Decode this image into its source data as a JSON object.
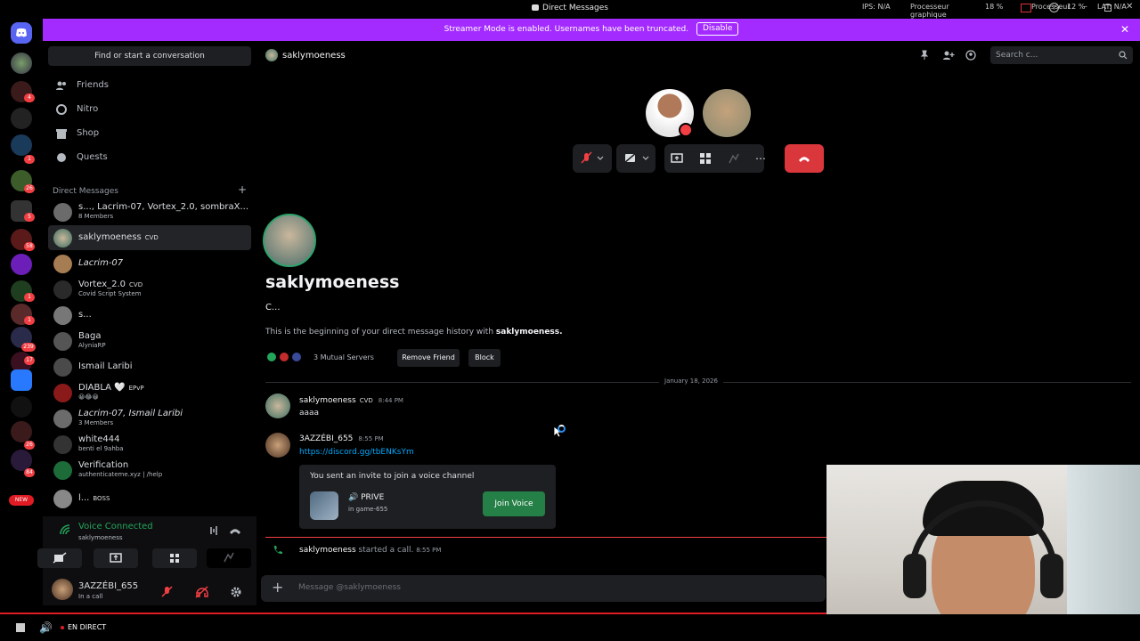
{
  "window": {
    "title": "Direct Messages",
    "stats": {
      "ips": "IPS: N/A",
      "gpu_label": "Processeur graphique",
      "gpu_value": "18 %",
      "cpu_label": "Processeur",
      "cpu_value": "12 %",
      "lat": "LAT: N/A"
    }
  },
  "banner": {
    "text": "Streamer Mode is enabled. Usernames have been truncated.",
    "disable_label": "Disable"
  },
  "sidebar": {
    "search_placeholder": "Find or start a conversation",
    "nav": [
      {
        "label": "Friends"
      },
      {
        "label": "Nitro"
      },
      {
        "label": "Shop"
      },
      {
        "label": "Quests"
      }
    ],
    "dm_header": "Direct Messages",
    "dms": [
      {
        "name": "s..., Lacrim-07, Vortex_2.0, sombraX...",
        "sub": "8 Members"
      },
      {
        "name": "saklymoeness",
        "tag": "CVD",
        "sub": ""
      },
      {
        "name": "Lacrim-07",
        "sub": ""
      },
      {
        "name": "Vortex_2.0",
        "tag": "CVD",
        "sub": "Covid Script System"
      },
      {
        "name": "s...",
        "sub": ""
      },
      {
        "name": "Baga",
        "sub": "AlyniaRP"
      },
      {
        "name": "Ismail Laribi",
        "sub": ""
      },
      {
        "name": "DIABLA 🤍",
        "tag": "EPvP",
        "sub": "😀😂😀"
      },
      {
        "name": "Lacrim-07, Ismail Laribi",
        "sub": "3 Members"
      },
      {
        "name": "white444",
        "sub": "benti el 9ahba"
      },
      {
        "name": "Verification",
        "sub": "authenticateme.xyz | /help"
      },
      {
        "name": "l...",
        "tag": "BOSS",
        "sub": ""
      }
    ],
    "voice": {
      "status": "Voice Connected",
      "channel": "saklymoeness"
    },
    "user": {
      "name": "3AZZÉBI_655",
      "status": "In a call"
    }
  },
  "server_rail": {
    "badges": [
      "4",
      "1",
      "26",
      "5",
      "58",
      "1",
      "1",
      "239",
      "17",
      "26",
      "84"
    ],
    "new_label": "NEW"
  },
  "header": {
    "name": "saklymoeness",
    "search_placeholder": "Search c..."
  },
  "profile": {
    "name": "saklymoeness",
    "bio": "C...",
    "intro_prefix": "This is the beginning of your direct message history with ",
    "intro_name": "saklymoeness.",
    "mutual_servers": "3 Mutual Servers",
    "remove_friend_label": "Remove Friend",
    "block_label": "Block"
  },
  "messages": {
    "date_divider": "January 18, 2026",
    "items": [
      {
        "author": "saklymoeness",
        "tag": "CVD",
        "time": "8:44 PM",
        "text": "aaaa"
      },
      {
        "author": "3AZZÉBI_655",
        "time": "8:55 PM",
        "text": "https://discord.gg/tbENKsYm"
      }
    ],
    "invite": {
      "title": "You sent an invite to join a voice channel",
      "channel": "PRIVE",
      "sub": "in game-655",
      "join_label": "Join Voice"
    },
    "call_event": {
      "author": "saklymoeness",
      "text": " started a call.",
      "time": "8:55 PM"
    }
  },
  "composer": {
    "placeholder": "Message @saklymoeness"
  },
  "obs": {
    "live_label": "EN DIRECT"
  },
  "colors": {
    "banner": "#a42bff",
    "hangup": "#da373c",
    "join": "#248046",
    "voice_green": "#23a55a",
    "link": "#00a8fc"
  }
}
